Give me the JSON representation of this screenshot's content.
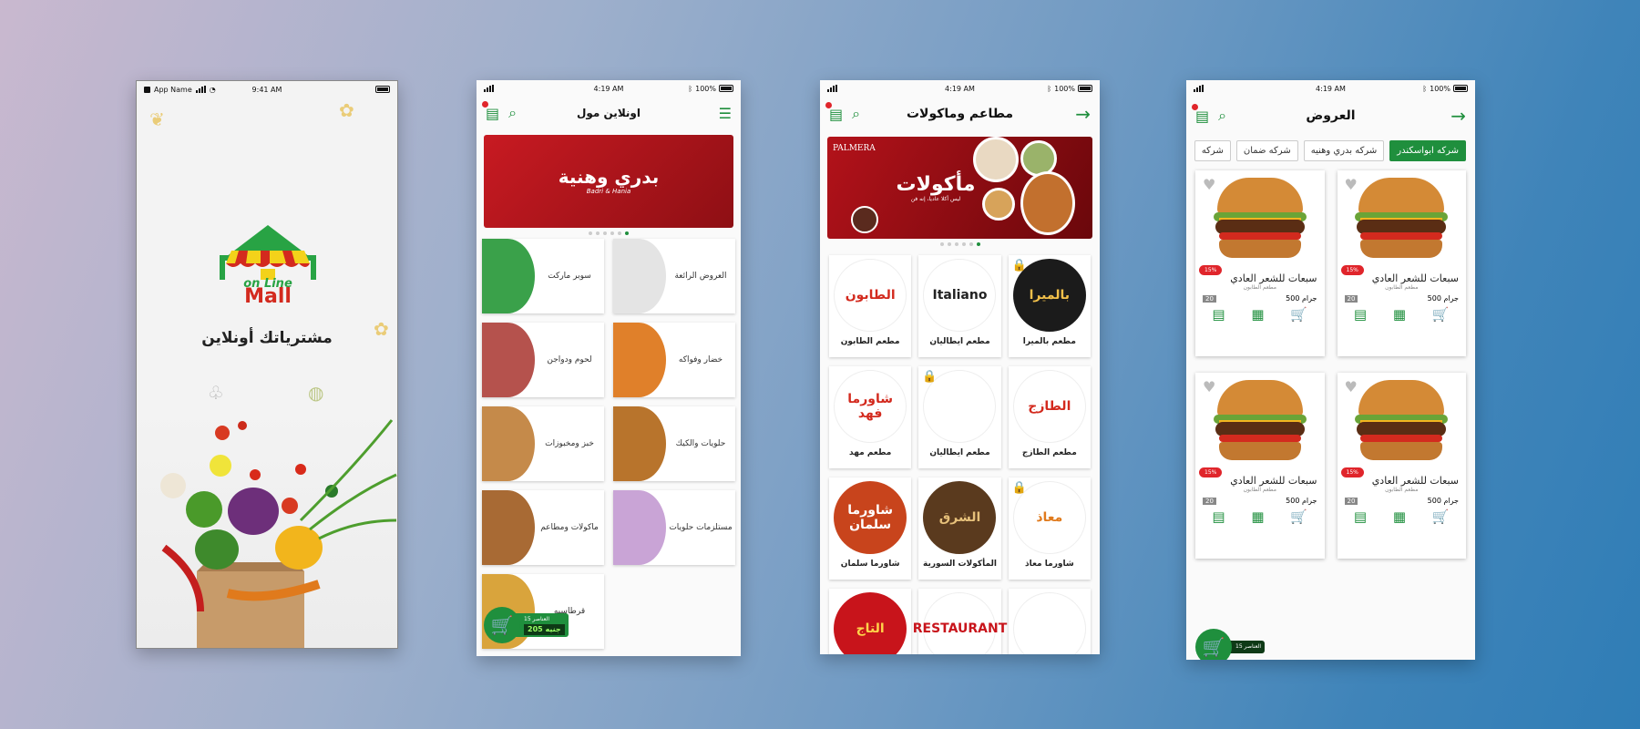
{
  "colors": {
    "brand_green": "#1f8f3d",
    "accent_red": "#e0252b",
    "banner_red": "#b8141b"
  },
  "splash": {
    "status": {
      "carrier": "App Name",
      "time": "9:41 AM"
    },
    "logo": {
      "line1": "on Line",
      "line2": "Mall"
    },
    "tagline": "مشترياتك أونلاين"
  },
  "home": {
    "status": {
      "time": "4:19 AM",
      "battery": "100%"
    },
    "title": "اونلاين مول",
    "banner": {
      "title": "بدري وهنية",
      "subtitle": "Badri & Hania"
    },
    "categories": [
      {
        "label": "سوبر ماركت",
        "color": "#3aa14a"
      },
      {
        "label": "العروض الرائعة",
        "color": "#e4e4e4"
      },
      {
        "label": "لحوم ودواجن",
        "color": "#b5524d"
      },
      {
        "label": "خضار وفواكه",
        "color": "#e0802a"
      },
      {
        "label": "خبز ومخبوزات",
        "color": "#c58a4a"
      },
      {
        "label": "حلويات والكيك",
        "color": "#b8742c"
      },
      {
        "label": "ماكولات ومطاعم",
        "color": "#a86a34"
      },
      {
        "label": "مستلزمات حلويات",
        "color": "#c9a4d6"
      },
      {
        "label": "قرطاسيه",
        "color": "#d9a43c"
      }
    ],
    "cart": {
      "items_label": "العناصر 15",
      "total": "205",
      "currency": "جنيه"
    }
  },
  "restaurants": {
    "status": {
      "time": "4:19 AM",
      "battery": "100%"
    },
    "title": "مطاعم وماكولات",
    "banner": {
      "brand": "PALMERA",
      "title": "مأكولات",
      "subtitle": "ليس أكلا عاديا، إنه فن"
    },
    "items": [
      {
        "name": "مطعم الطابون",
        "logo_text": "الطابون",
        "color": "#ffffff",
        "text_color": "#d32a1e",
        "locked": false
      },
      {
        "name": "مطعم ايطاليان",
        "logo_text": "Italiano",
        "color": "#ffffff",
        "text_color": "#222222",
        "locked": false
      },
      {
        "name": "مطعم بالميرا",
        "logo_text": "بالميرا",
        "color": "#1b1b1b",
        "text_color": "#f2c04a",
        "locked": true
      },
      {
        "name": "مطعم مهد",
        "logo_text": "شاورما فهد",
        "color": "#ffffff",
        "text_color": "#d32a1e",
        "locked": false
      },
      {
        "name": "مطعم ايطاليان",
        "logo_text": "",
        "color": "#ffffff",
        "text_color": "#d32a1e",
        "locked": true
      },
      {
        "name": "مطعم الطازج",
        "logo_text": "الطازج",
        "color": "#ffffff",
        "text_color": "#d32a1e",
        "locked": false
      },
      {
        "name": "شاورما سلمان",
        "logo_text": "شاورما سلمان",
        "color": "#c8441c",
        "text_color": "#ffffff",
        "locked": false
      },
      {
        "name": "المأكولات السورية",
        "logo_text": "الشرق",
        "color": "#5a3a1e",
        "text_color": "#e6c07a",
        "locked": false
      },
      {
        "name": "شاورما معاذ",
        "logo_text": "معاذ",
        "color": "#ffffff",
        "text_color": "#e07a1c",
        "locked": true
      },
      {
        "name": "",
        "logo_text": "التاج",
        "color": "#c8141b",
        "text_color": "#ffd34a",
        "locked": false
      },
      {
        "name": "",
        "logo_text": "RESTAURANT",
        "color": "#ffffff",
        "text_color": "#c8141b",
        "locked": false
      },
      {
        "name": "",
        "logo_text": "",
        "color": "#ffffff",
        "text_color": "#e0252b",
        "locked": false
      }
    ]
  },
  "offers": {
    "status": {
      "time": "4:19 AM",
      "battery": "100%"
    },
    "title": "العروض",
    "chips": [
      "شركه ابواسكندر",
      "شركه بدري وهنيه",
      "شركه ضمان",
      "شركه"
    ],
    "products": [
      {
        "title": "سبعات للشعر العادي",
        "vendor": "مطعم الطابون",
        "weight": "جرام 500",
        "qty": "20",
        "discount": "15%"
      },
      {
        "title": "سبعات للشعر العادي",
        "vendor": "مطعم الطابون",
        "weight": "جرام 500",
        "qty": "20",
        "discount": "15%"
      },
      {
        "title": "سبعات للشعر العادي",
        "vendor": "مطعم الطابون",
        "weight": "جرام 500",
        "qty": "20",
        "discount": "15%"
      },
      {
        "title": "سبعات للشعر العادي",
        "vendor": "مطعم الطابون",
        "weight": "جرام 500",
        "qty": "20",
        "discount": "15%"
      }
    ],
    "cart": {
      "items_label": "العناصر 15"
    }
  }
}
